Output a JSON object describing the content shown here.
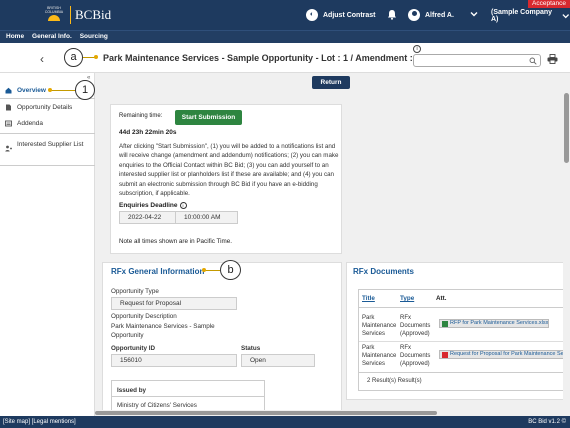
{
  "topbar": {
    "logo_small": "BRITISH COLUMBIA",
    "logo_name": "BCBid",
    "acceptance": "Acceptance",
    "adjust_contrast": "Adjust Contrast",
    "user_name": "Alfred A.",
    "company": "(Sample Company A)"
  },
  "nav": {
    "items": [
      "Home",
      "General Info.",
      "Sourcing"
    ]
  },
  "title": {
    "text": "Park Maintenance Services - Sample Opportunity - Lot : 1 / Amendment : 0",
    "search_placeholder": ""
  },
  "callouts": {
    "a": "a",
    "one": "1",
    "b": "b"
  },
  "sidebar": {
    "collapse": "«",
    "items": [
      {
        "label": "Overview",
        "icon": "home-icon"
      },
      {
        "label": "Opportunity Details",
        "icon": "document-icon"
      },
      {
        "label": "Addenda",
        "icon": "list-icon"
      },
      {
        "label": "Interested Supplier List",
        "icon": "users-icon"
      }
    ]
  },
  "return_label": "Return",
  "submission": {
    "remaining_label": "Remaining time:",
    "start_button": "Start Submission",
    "countdown": "44d 23h 22min 20s",
    "paragraph": "After clicking \"Start Submission\", (1) you will be added to a notifications list and will receive change (amendment and addendum) notifications; (2) you can make enquiries to the Official Contact within BC Bid; (3) you can add yourself to an interested supplier list or planholders list if these are available; and (4) you can submit an electronic submission through BC Bid if you have an e-bidding subscription, if applicable.",
    "enquiries_label": "Enquiries Deadline",
    "enquiries_date": "2022-04-22",
    "enquiries_time": "10:00:00 AM",
    "note": "Note all times shown are in Pacific Time."
  },
  "general_info": {
    "title": "RFx General Information",
    "type_label": "Opportunity Type",
    "type_value": "Request for Proposal",
    "desc_label": "Opportunity Description",
    "desc_value": "Park Maintenance Services - Sample Opportunity",
    "id_label": "Opportunity ID",
    "id_value": "156010",
    "status_label": "Status",
    "status_value": "Open",
    "issued_label": "Issued by",
    "issued_value": "Ministry of Citizens' Services"
  },
  "documents": {
    "title": "RFx Documents",
    "col_title": "Title",
    "col_type": "Type",
    "col_att": "Att.",
    "rows": [
      {
        "title": "Park Maintenance Services",
        "type": "RFx Documents (Approved)",
        "file": "RFP for Park Maintenance Services.xlsx",
        "file_color": "#2e8540"
      },
      {
        "title": "Park Maintenance Services",
        "type": "RFx Documents (Approved)",
        "file": "Request for Proposal for Park Maintenance Se",
        "file_color": "#d8292f"
      }
    ],
    "results": "2 Result(s) Result(s)"
  },
  "footer": {
    "left": "[Site map] [Legal mentions]",
    "right": "BC Bid v1.2 ©"
  },
  "colors": {
    "header": "#1e3a5f",
    "accent": "#1a5a96",
    "start": "#2e8540",
    "acceptance": "#d8292f",
    "callout_line": "#c49a00"
  }
}
